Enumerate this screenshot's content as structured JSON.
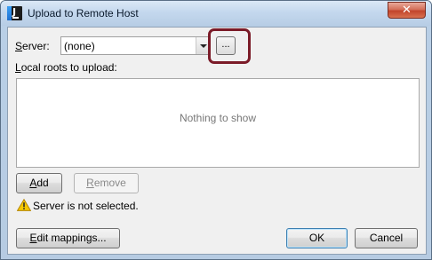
{
  "window": {
    "title": "Upload to Remote Host",
    "close_label": "✕"
  },
  "server": {
    "label": "Server:",
    "label_access_key": "S",
    "label_rest": "erver:",
    "value": "(none)",
    "browse_label": "..."
  },
  "roots": {
    "label_access_key": "L",
    "label_rest": "ocal roots to upload:",
    "empty_text": "Nothing to show"
  },
  "buttons": {
    "add_key": "A",
    "add_rest": "dd",
    "remove_key": "R",
    "remove_rest": "emove",
    "edit_key": "E",
    "edit_rest": "dit mappings...",
    "ok": "OK",
    "cancel": "Cancel"
  },
  "warning": {
    "icon": "warning-icon",
    "text": "Server is not selected."
  },
  "colors": {
    "highlight": "#7b1b28",
    "warning_yellow": "#f5c800"
  }
}
